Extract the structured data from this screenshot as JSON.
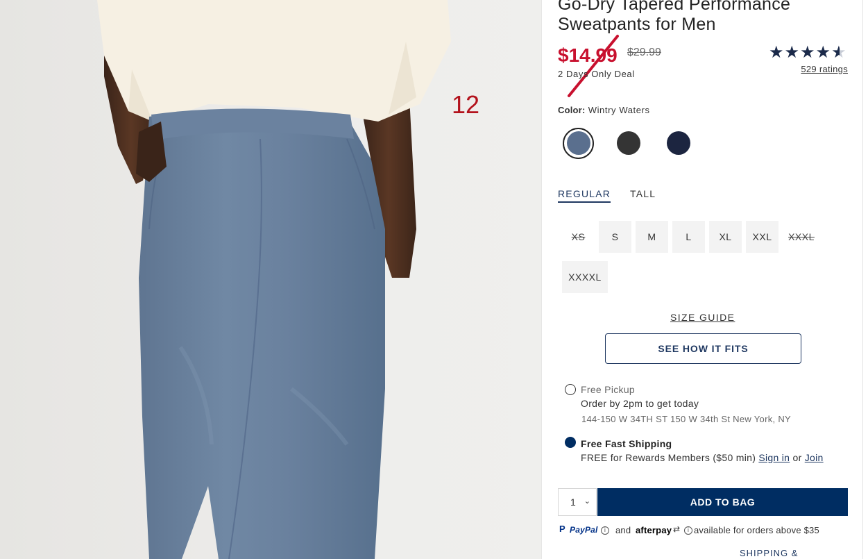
{
  "overlay": {
    "number": "12"
  },
  "product": {
    "title": "Go-Dry Tapered Performance Sweatpants for Men",
    "sale_price": "$14.99",
    "original_price": "$29.99",
    "deal_text": "2 Days Only Deal",
    "rating": {
      "stars": 4.5,
      "ratings_link": "529 ratings"
    }
  },
  "color": {
    "label": "Color:",
    "selected_name": "Wintry Waters",
    "swatches": [
      {
        "name": "Wintry Waters",
        "hex": "#5a6f8e",
        "selected": true
      },
      {
        "name": "Charcoal",
        "hex": "#343434",
        "selected": false
      },
      {
        "name": "Navy",
        "hex": "#1c2540",
        "selected": false
      }
    ]
  },
  "fit_tabs": [
    {
      "label": "REGULAR",
      "active": true
    },
    {
      "label": "TALL",
      "active": false
    }
  ],
  "sizes": [
    {
      "label": "XS",
      "available": false
    },
    {
      "label": "S",
      "available": true
    },
    {
      "label": "M",
      "available": true
    },
    {
      "label": "L",
      "available": true
    },
    {
      "label": "XL",
      "available": true
    },
    {
      "label": "XXL",
      "available": true
    },
    {
      "label": "XXXL",
      "available": false
    },
    {
      "label": "XXXXL",
      "available": true
    }
  ],
  "size_guide": "SIZE GUIDE",
  "see_how_it_fits": "SEE HOW IT FITS",
  "shipping": {
    "pickup": {
      "title": "Free Pickup",
      "line1": "Order by 2pm to get today",
      "address": "144-150 W 34TH ST 150 W 34th St New York, NY",
      "selected": false
    },
    "fast": {
      "title": "Free Fast Shipping",
      "line1_prefix": "FREE for Rewards Members ($50 min)",
      "sign_in": "Sign in",
      "or": "or",
      "join": "Join",
      "selected": true
    }
  },
  "cart": {
    "qty": "1",
    "add_to_bag": "ADD TO BAG"
  },
  "payments": {
    "paypal": "PayPal",
    "and": "and",
    "afterpay": "afterpay",
    "note": "available for orders above $35"
  },
  "shipping_returns": "SHIPPING & RETURNS",
  "colors": {
    "accent": "#002d62",
    "sale": "#c8102e",
    "overlay_red": "#b3121c"
  }
}
